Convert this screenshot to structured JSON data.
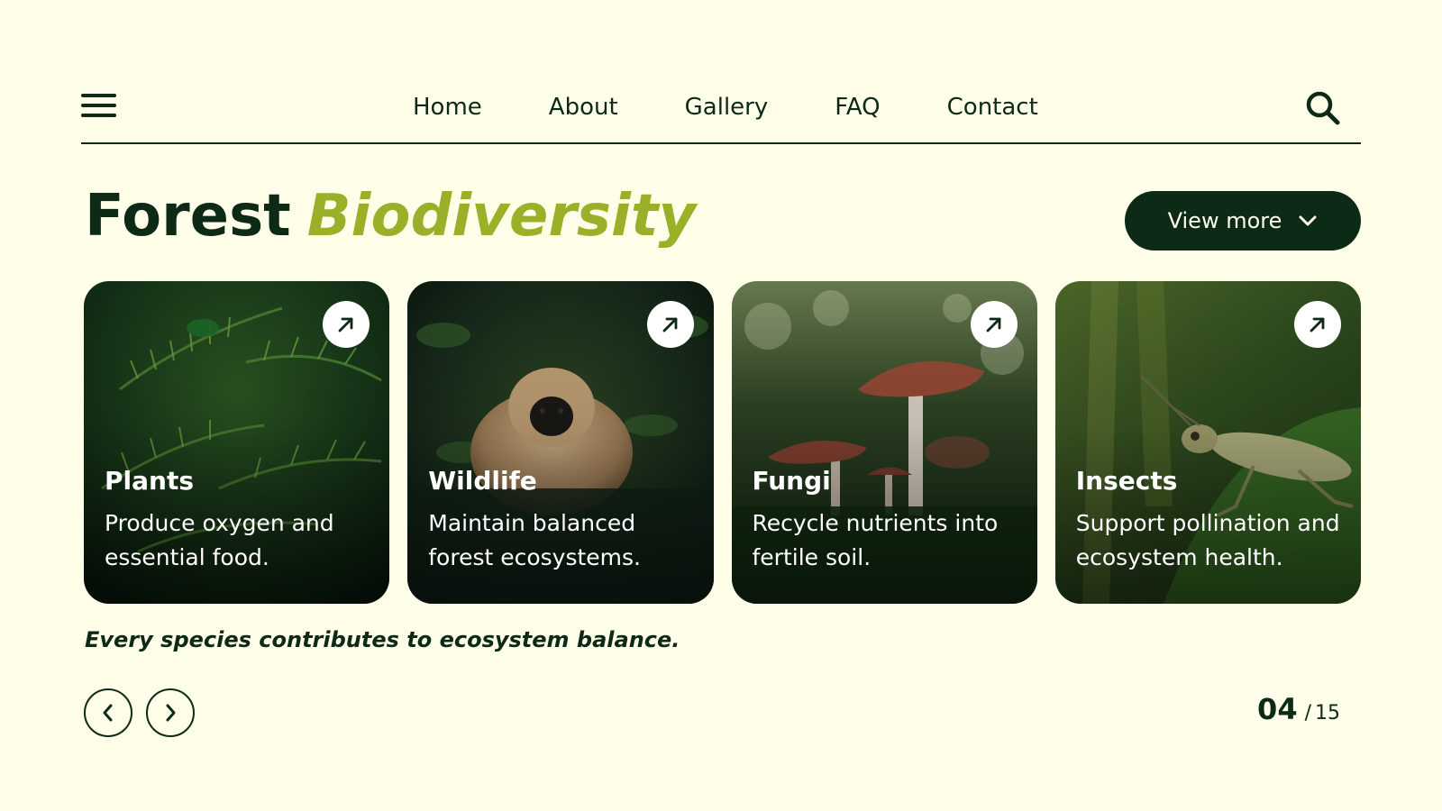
{
  "header": {
    "nav": [
      {
        "label": "Home"
      },
      {
        "label": "About"
      },
      {
        "label": "Gallery"
      },
      {
        "label": "FAQ"
      },
      {
        "label": "Contact"
      }
    ]
  },
  "hero": {
    "title_part1": "Forest",
    "title_part2": "Biodiversity",
    "view_more_label": "View more"
  },
  "cards": [
    {
      "title": "Plants",
      "desc": "Produce oxygen and essential food."
    },
    {
      "title": "Wildlife",
      "desc": "Maintain balanced forest ecosystems."
    },
    {
      "title": "Fungi",
      "desc": "Recycle nutrients into fertile soil."
    },
    {
      "title": "Insects",
      "desc": "Support pollination and ecosystem health."
    }
  ],
  "tagline": "Every species contributes to ecosystem balance.",
  "pager": {
    "current": "04",
    "separator": "/",
    "total": "15"
  },
  "colors": {
    "background": "#fefee9",
    "primary": "#0c2a16",
    "accent": "#9bb029"
  }
}
